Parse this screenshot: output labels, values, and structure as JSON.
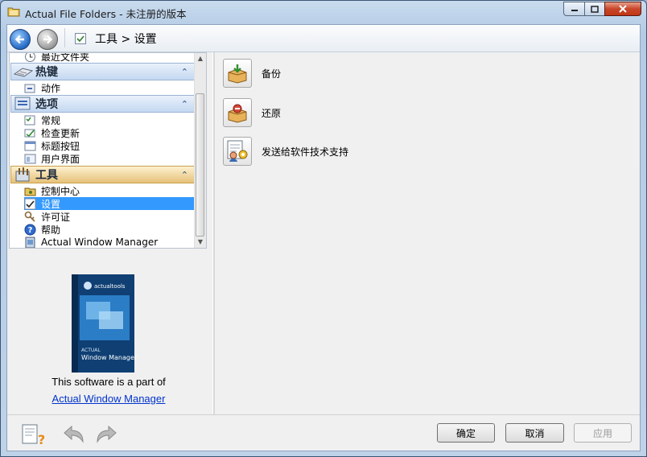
{
  "window": {
    "title": "Actual File Folders - 未注册的版本"
  },
  "toolbar": {
    "breadcrumb": "工具 > 设置"
  },
  "sidebar": {
    "partial_item": "最近文件夹",
    "groups": [
      {
        "label": "热键",
        "items": [
          "动作"
        ]
      },
      {
        "label": "选项",
        "items": [
          "常规",
          "检查更新",
          "标题按钮",
          "用户界面"
        ]
      },
      {
        "label": "工具",
        "items": [
          "控制中心",
          "设置",
          "许可证",
          "帮助",
          "Actual Window Manager"
        ]
      }
    ],
    "selected": "设置",
    "collapse_glyph": "«"
  },
  "promo": {
    "box_brand": "actualtools",
    "box_line1": "ACTUAL",
    "box_line2": "Window Manager",
    "text": "This software is a part of",
    "link": "Actual Window Manager"
  },
  "actions": [
    {
      "label": "备份",
      "icon": "backup-icon"
    },
    {
      "label": "还原",
      "icon": "restore-icon"
    },
    {
      "label": "发送给软件技术支持",
      "icon": "support-icon"
    }
  ],
  "footer": {
    "ok": "确定",
    "cancel": "取消",
    "apply": "应用"
  },
  "colors": {
    "selection": "#3399ff",
    "link": "#0033cc",
    "group_blue": "#c4d8f1",
    "group_gold": "#e6c27a"
  }
}
